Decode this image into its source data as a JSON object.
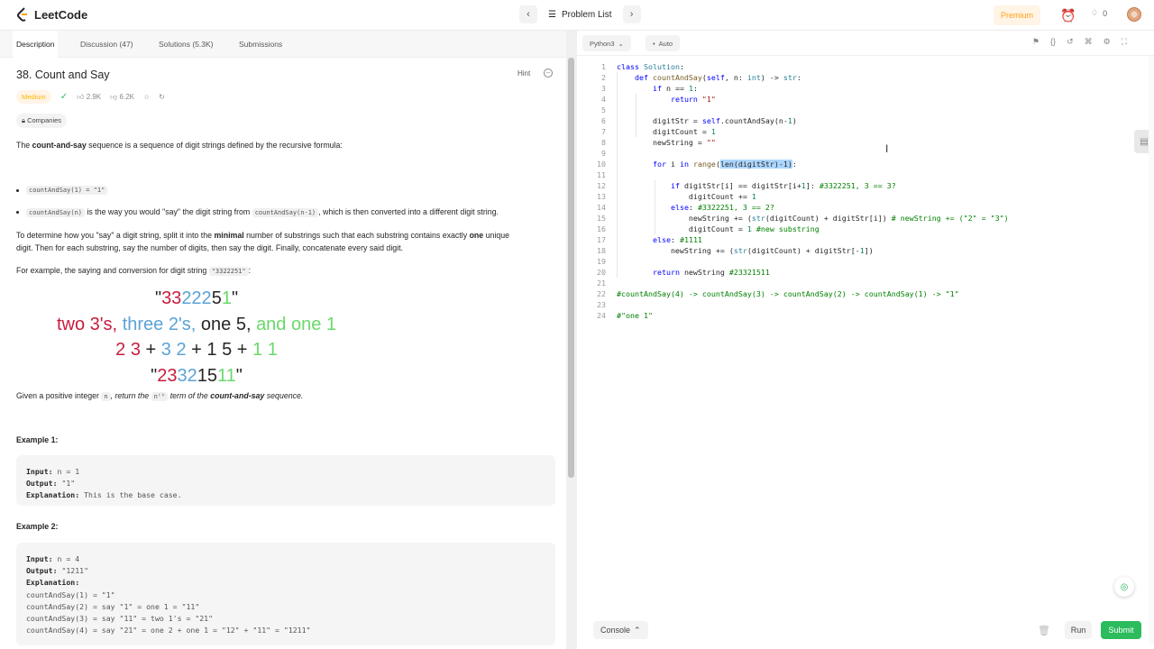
{
  "topbar": {
    "logo": "LeetCode",
    "problem_list": "Problem List",
    "premium": "Premium",
    "streak": "0"
  },
  "tabs": [
    "Description",
    "Discussion (47)",
    "Solutions (5.3K)",
    "Submissions"
  ],
  "problem": {
    "title": "38. Count and Say",
    "hint": "Hint",
    "difficulty": "Medium",
    "likes": "2.9K",
    "dislikes": "6.2K",
    "companies": "Companies",
    "intro_pre": "The ",
    "intro_bold": "count-and-say",
    "intro_post": " sequence is a sequence of digit strings defined by the recursive formula:",
    "b1_code": "countAndSay(1) = \"1\"",
    "b2_code": "countAndSay(n)",
    "b2_mid": " is the way you would \"say\" the digit string from ",
    "b2_code2": "countAndSay(n-1)",
    "b2_post": ", which is then converted into a different digit string.",
    "p2_a": "To determine how you \"say\" a digit string, split it into the ",
    "p2_b": "minimal",
    "p2_c": " number of substrings such that each substring contains exactly ",
    "p2_d": "one",
    "p2_e": " unique",
    "p2_line2": "digit. Then for each substring, say the number of digits, then say the digit. Finally, concatenate every said digit.",
    "p3_pre": "For example, the saying and conversion for digit string ",
    "p3_code": "\"3322251\"",
    "p3_post": ":",
    "diagram": {
      "r1": [
        "\"",
        "33",
        "222",
        "5",
        "1",
        "\""
      ],
      "r2": [
        "two 3's,",
        "three 2's,",
        "one 5,",
        "and one 1"
      ],
      "r3": [
        "2 3",
        "+",
        "3 2",
        "+",
        "1 5",
        "+",
        "1 1"
      ],
      "r4": [
        "\"",
        "23",
        "32",
        "15",
        "11",
        "\""
      ]
    },
    "p4_pre": "Given a positive integer ",
    "p4_code": "n",
    "p4_mid": ", return the ",
    "p4_code2": "nᵗʰ",
    "p4_mid2": " term of the ",
    "p4_bold": "count-and-say",
    "p4_post": " sequence.",
    "ex1_title": "Example 1:",
    "ex1": [
      {
        "k": "Input:",
        "v": " n = 1"
      },
      {
        "k": "Output:",
        "v": " \"1\""
      },
      {
        "k": "Explanation:",
        "v": " This is the base case."
      }
    ],
    "ex2_title": "Example 2:",
    "ex2": [
      {
        "k": "Input:",
        "v": " n = 4"
      },
      {
        "k": "Output:",
        "v": " \"1211\""
      },
      {
        "k": "Explanation:",
        "v": ""
      },
      {
        "k": "",
        "v": "countAndSay(1) = \"1\""
      },
      {
        "k": "",
        "v": "countAndSay(2) = say \"1\" = one 1 = \"11\""
      },
      {
        "k": "",
        "v": "countAndSay(3) = say \"11\" = two 1's = \"21\""
      },
      {
        "k": "",
        "v": "countAndSay(4) = say \"21\" = one 2 + one 1 = \"12\" + \"11\" = \"1211\""
      }
    ]
  },
  "editor": {
    "language": "Python3",
    "mode": "Auto",
    "console": "Console",
    "run": "Run",
    "submit": "Submit"
  }
}
